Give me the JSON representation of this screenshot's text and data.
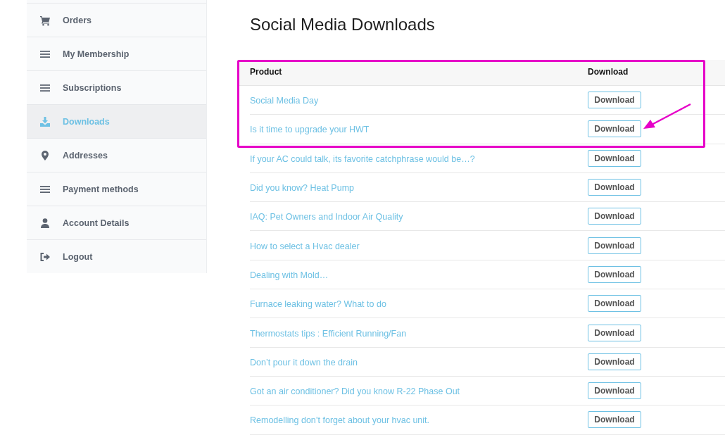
{
  "sidebar": {
    "items": [
      {
        "label": "Orders",
        "kind": "cart",
        "selected": false
      },
      {
        "label": "My Membership",
        "kind": "list",
        "selected": false
      },
      {
        "label": "Subscriptions",
        "kind": "list",
        "selected": false
      },
      {
        "label": "Downloads",
        "kind": "download",
        "selected": true
      },
      {
        "label": "Addresses",
        "kind": "pin",
        "selected": false
      },
      {
        "label": "Payment methods",
        "kind": "list",
        "selected": false
      },
      {
        "label": "Account Details",
        "kind": "user",
        "selected": false
      },
      {
        "label": "Logout",
        "kind": "logout",
        "selected": false
      }
    ]
  },
  "page_title": "Social Media Downloads",
  "table": {
    "columns": [
      "Product",
      "Download"
    ],
    "rows": [
      {
        "product": "Social Media Day",
        "button": "Download"
      },
      {
        "product": "Is it time to upgrade your HWT",
        "button": "Download"
      },
      {
        "product": "If your AC could talk, its favorite catchphrase would be…?",
        "button": "Download"
      },
      {
        "product": "Did you know? Heat Pump",
        "button": "Download"
      },
      {
        "product": "IAQ: Pet Owners and Indoor Air Quality",
        "button": "Download"
      },
      {
        "product": "How to select a Hvac dealer",
        "button": "Download"
      },
      {
        "product": "Dealing with Mold…",
        "button": "Download"
      },
      {
        "product": "Furnace leaking water? What to do",
        "button": "Download"
      },
      {
        "product": "Thermostats tips : Efficient Running/Fan",
        "button": "Download"
      },
      {
        "product": "Don’t pour it down the drain",
        "button": "Download"
      },
      {
        "product": "Got an air conditioner? Did you know R-22 Phase Out",
        "button": "Download"
      },
      {
        "product": "Remodelling don’t forget about your hvac unit.",
        "button": "Download"
      }
    ]
  }
}
